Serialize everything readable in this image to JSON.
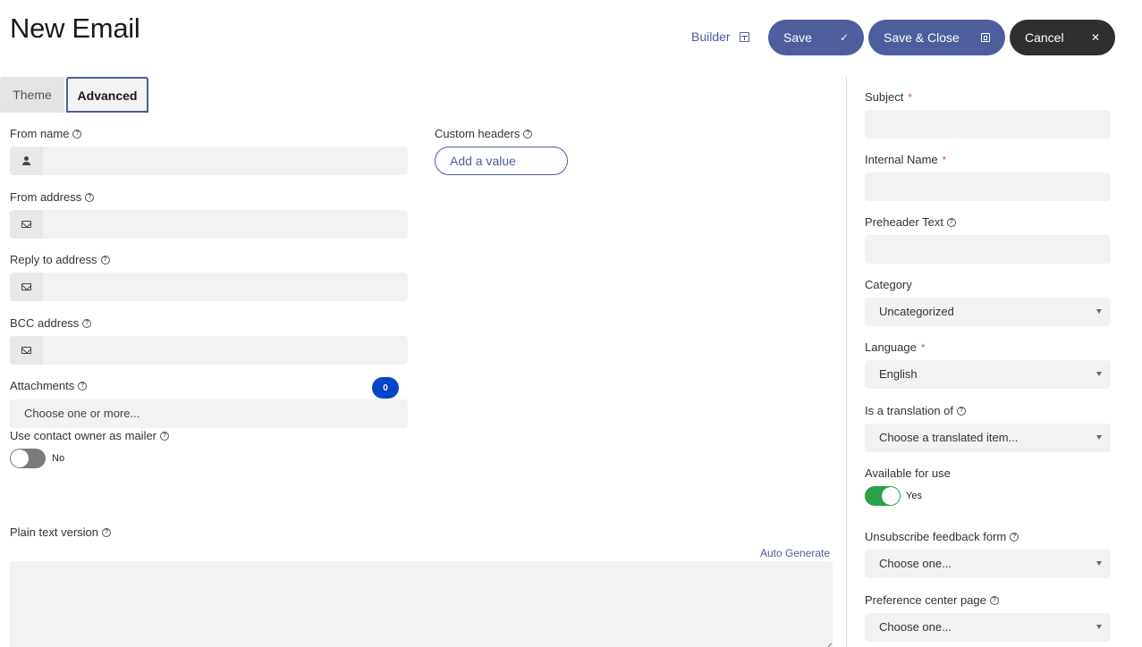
{
  "header": {
    "title": "New Email",
    "builder_label": "Builder",
    "save_label": "Save",
    "save_close_label": "Save & Close",
    "cancel_label": "Cancel"
  },
  "tabs": [
    {
      "label": "Theme",
      "active": false
    },
    {
      "label": "Advanced",
      "active": true
    }
  ],
  "advanced": {
    "from_name": {
      "label": "From name",
      "value": "",
      "icon": "user-icon"
    },
    "from_address": {
      "label": "From address",
      "value": "",
      "icon": "envelope-icon"
    },
    "reply_to": {
      "label": "Reply to address",
      "value": "",
      "icon": "envelope-icon"
    },
    "bcc": {
      "label": "BCC address",
      "value": "",
      "icon": "envelope-icon"
    },
    "attachments": {
      "label": "Attachments",
      "placeholder": "Choose one or more...",
      "count": "0"
    },
    "contact_owner": {
      "label": "Use contact owner as mailer",
      "state": "No"
    },
    "custom_headers": {
      "label": "Custom headers",
      "add_label": "Add a value"
    },
    "plain_text": {
      "label": "Plain text version",
      "auto_generate": "Auto Generate",
      "value": ""
    }
  },
  "sidebar": {
    "subject": {
      "label": "Subject",
      "required": "*",
      "value": ""
    },
    "internal_name": {
      "label": "Internal Name",
      "required": "*",
      "value": ""
    },
    "preheader": {
      "label": "Preheader Text",
      "value": ""
    },
    "category": {
      "label": "Category",
      "selected": "Uncategorized"
    },
    "language": {
      "label": "Language",
      "required": "*",
      "selected": "English"
    },
    "translation": {
      "label": "Is a translation of",
      "selected": "Choose a translated item..."
    },
    "available": {
      "label": "Available for use",
      "state": "Yes"
    },
    "unsubscribe": {
      "label": "Unsubscribe feedback form",
      "selected": "Choose one..."
    },
    "preference": {
      "label": "Preference center page",
      "selected": "Choose one..."
    }
  },
  "colors": {
    "primary": "#4e5d9d",
    "dark": "#2f2f2f",
    "toggle_on": "#2aa24a",
    "toggle_off": "#7b7b7b",
    "badge": "#0645c9"
  }
}
